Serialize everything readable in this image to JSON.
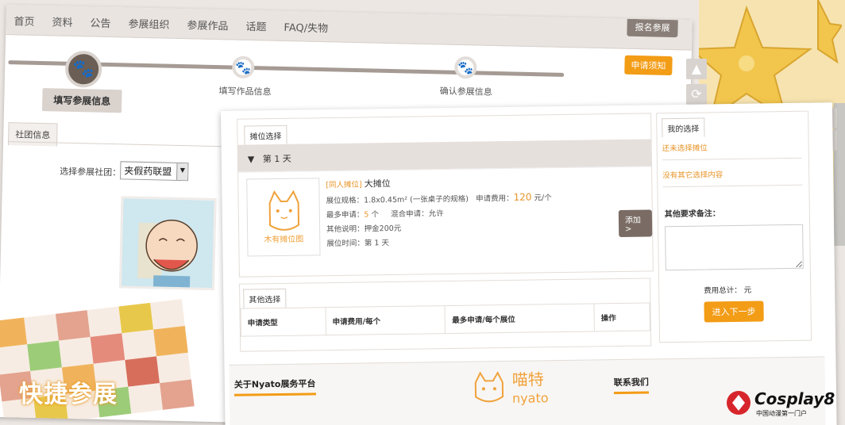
{
  "nav": {
    "items": [
      "首页",
      "资料",
      "公告",
      "参展组织",
      "参展作品",
      "话题",
      "FAQ/失物"
    ],
    "apply_label": "报名参展",
    "notice_label": "申请须知"
  },
  "steps": [
    {
      "label": "填写参展信息",
      "active": true
    },
    {
      "label": "填写作品信息",
      "active": false
    },
    {
      "label": "确认参展信息",
      "active": false
    }
  ],
  "club": {
    "tab_label": "社团信息",
    "select_label": "选择参展社团：",
    "selected_value": "夹假药联盟"
  },
  "quick_title": "快捷参展",
  "booth": {
    "tab_label": "摊位选择",
    "day_label": "第 1 天",
    "no_image_text": "木有摊位图",
    "tag": "[同人摊位]",
    "name": "大摊位",
    "spec_label": "展位规格：",
    "spec_value": "1.8x0.45m² (一张桌子的规格)",
    "fee_label": "申请费用：",
    "fee_value": "120",
    "fee_unit": "元/个",
    "max_label": "最多申请：",
    "max_value": "5",
    "max_unit": "个",
    "mixed_label": "混合申请：",
    "mixed_value": "允许",
    "other_label": "其他说明：",
    "other_value": "押金200元",
    "time_label": "展位时间：",
    "time_value": "第 1 天",
    "add_label": "添加>"
  },
  "other": {
    "tab_label": "其他选择",
    "columns": [
      "申请类型",
      "申请费用/每个",
      "最多申请/每个展位",
      "操作"
    ]
  },
  "my_choice": {
    "tab_label": "我的选择",
    "no_booth": "还未选择摊位",
    "no_other": "没有其它选择内容",
    "remark_label": "其他要求备注：",
    "remark_value": "",
    "fee_total": "费用总计：  元",
    "next_label": "进入下一步"
  },
  "footer": {
    "about": "关于Nyato展务平台",
    "contact": "联系我们",
    "logo_cn": "喵特",
    "logo_en": "nyato"
  },
  "watermark": {
    "brand": "Cosplay8",
    "tagline": "中国动漫第一门户"
  },
  "colors": {
    "accent_orange": "#f39c16",
    "dark_brown": "#6a5e55",
    "nav_bg": "#e9e4e0"
  }
}
